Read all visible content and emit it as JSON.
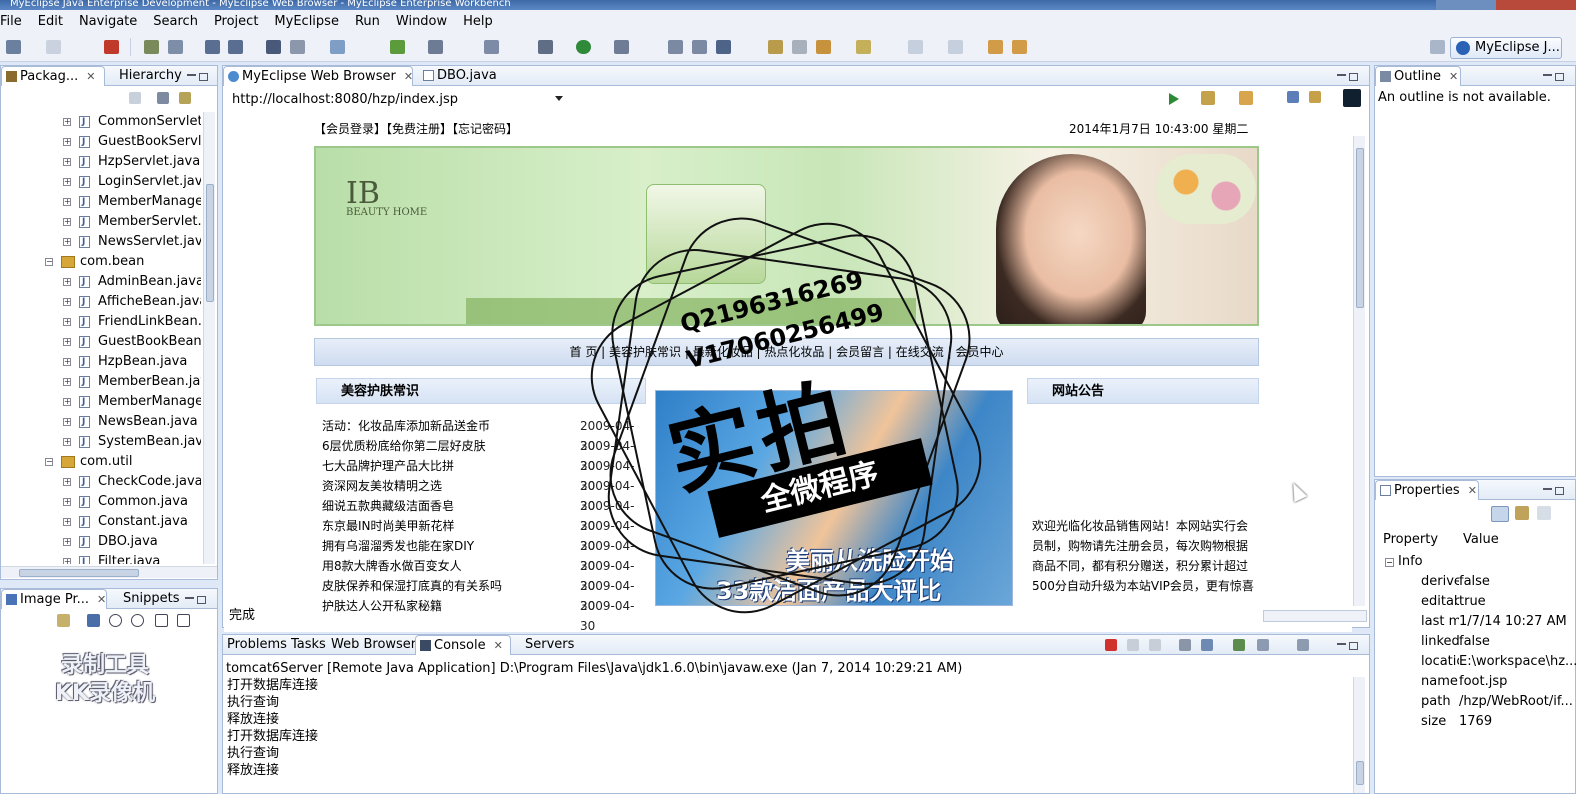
{
  "window": {
    "title": "MyEclipse Java Enterprise Development - MyEclipse Web Browser - MyEclipse Enterprise Workbench"
  },
  "menu": [
    "File",
    "Edit",
    "Navigate",
    "Search",
    "Project",
    "MyEclipse",
    "Run",
    "Window",
    "Help"
  ],
  "perspective": {
    "label": "MyEclipse J..."
  },
  "left_panel": {
    "tabs": [
      "Packag...",
      "Hierarchy"
    ],
    "tree": [
      {
        "label": "CommonServlet.ja",
        "type": "file",
        "indent": 2
      },
      {
        "label": "GuestBookServlet",
        "type": "file",
        "indent": 2
      },
      {
        "label": "HzpServlet.java",
        "type": "file",
        "indent": 2
      },
      {
        "label": "LoginServlet.java",
        "type": "file",
        "indent": 2
      },
      {
        "label": "MemberManageS",
        "type": "file",
        "indent": 2
      },
      {
        "label": "MemberServlet.ja",
        "type": "file",
        "indent": 2
      },
      {
        "label": "NewsServlet.java",
        "type": "file",
        "indent": 2
      },
      {
        "label": "com.bean",
        "type": "package",
        "indent": 1
      },
      {
        "label": "AdminBean.java",
        "type": "file",
        "indent": 2
      },
      {
        "label": "AfficheBean.java",
        "type": "file",
        "indent": 2
      },
      {
        "label": "FriendLinkBean.ja",
        "type": "file",
        "indent": 2
      },
      {
        "label": "GuestBookBean.ja",
        "type": "file",
        "indent": 2
      },
      {
        "label": "HzpBean.java",
        "type": "file",
        "indent": 2
      },
      {
        "label": "MemberBean.java",
        "type": "file",
        "indent": 2
      },
      {
        "label": "MemberManageB",
        "type": "file",
        "indent": 2
      },
      {
        "label": "NewsBean.java",
        "type": "file",
        "indent": 2
      },
      {
        "label": "SystemBean.java",
        "type": "file",
        "indent": 2
      },
      {
        "label": "com.util",
        "type": "package",
        "indent": 1
      },
      {
        "label": "CheckCode.java",
        "type": "file",
        "indent": 2
      },
      {
        "label": "Common.java",
        "type": "file",
        "indent": 2
      },
      {
        "label": "Constant.java",
        "type": "file",
        "indent": 2
      },
      {
        "label": "DBO.java",
        "type": "file",
        "indent": 2
      },
      {
        "label": "Filter.java",
        "type": "file",
        "indent": 2
      }
    ]
  },
  "image_panel": {
    "tabs": [
      "Image Pr...",
      "Snippets"
    ],
    "watermark_lines": [
      "录制工具",
      "KK录像机"
    ]
  },
  "editor": {
    "tabs": [
      "MyEclipse Web Browser",
      "DBO.java"
    ],
    "url": "http://localhost:8080/hzp/index.jsp",
    "status": "完成",
    "web": {
      "top_links": "【会员登录】【免费注册】【忘记密码】",
      "datetime": "2014年1月7日 10:43:00  星期二",
      "banner_logo": "IB",
      "banner_brand": "BEAUTY HOME",
      "nav": [
        "首 页",
        "美容护肤常识",
        "最新化妆品",
        "热点化妆品",
        "会员留言",
        "在线交流",
        "会员中心"
      ],
      "col1_title": "美容护肤常识",
      "col3_title": "网站公告",
      "news": [
        {
          "title": "活动：化妆品库添加新品送金币",
          "date": "2009-04-30"
        },
        {
          "title": "6层优质粉底给你第二层好皮肤",
          "date": "2009-04-30"
        },
        {
          "title": "七大品牌护理产品大比拼",
          "date": "2009-04-30"
        },
        {
          "title": "资深网友美妆精明之选",
          "date": "2009-04-30"
        },
        {
          "title": "细说五款典藏级洁面香皂",
          "date": "2009-04-30"
        },
        {
          "title": "东京最IN时尚美甲新花样",
          "date": "2009-04-30"
        },
        {
          "title": "拥有乌溜溜秀发也能在家DIY",
          "date": "2009-04-30"
        },
        {
          "title": "用8款大牌香水做百变女人",
          "date": "2009-04-30"
        },
        {
          "title": "皮肤保养和保湿打底真的有关系吗",
          "date": "2009-04-30"
        },
        {
          "title": "护肤达人公开私家秘籍",
          "date": "2009-04-30"
        }
      ],
      "ad_line1": "美丽从洗脸开始",
      "ad_line2": "33款洁面产品大评比",
      "notice": "欢迎光临化妆品销售网站！本网站实行会员制，购物请先注册会员，每次购物根据商品不同，都有积分赠送，积分累计超过500分自动升级为本站VIP会员，更有惊喜"
    }
  },
  "outline": {
    "tab": "Outline",
    "message": "An outline is not available."
  },
  "properties": {
    "tab": "Properties",
    "header": [
      "Property",
      "Value"
    ],
    "group": "Info",
    "rows": [
      {
        "key": "derive",
        "value": "false"
      },
      {
        "key": "editab",
        "value": "true"
      },
      {
        "key": "last m",
        "value": "1/7/14 10:27 AM"
      },
      {
        "key": "linked",
        "value": "false"
      },
      {
        "key": "locatic",
        "value": "E:\\workspace\\hz..."
      },
      {
        "key": "name",
        "value": "foot.jsp"
      },
      {
        "key": "path",
        "value": "/hzp/WebRoot/if..."
      },
      {
        "key": "size",
        "value": "1769"
      }
    ]
  },
  "console": {
    "tabs": [
      "Problems",
      "Tasks",
      "Web Browser",
      "Console",
      "Servers"
    ],
    "header": "tomcat6Server [Remote Java Application] D:\\Program Files\\Java\\jdk1.6.0\\bin\\javaw.exe (Jan 7, 2014 10:29:21 AM)",
    "lines": [
      "打开数据库连接",
      "执行查询",
      "释放连接",
      "打开数据库连接",
      "执行查询",
      "释放连接"
    ]
  },
  "stamp": {
    "line1": "Q2196316269",
    "line2": "V17060256499",
    "main": "实拍",
    "band": "全微程序"
  },
  "colors": {
    "accent": "#2a62b5",
    "panel_border": "#a8bbd8",
    "banner_green": "#b9dea8"
  }
}
